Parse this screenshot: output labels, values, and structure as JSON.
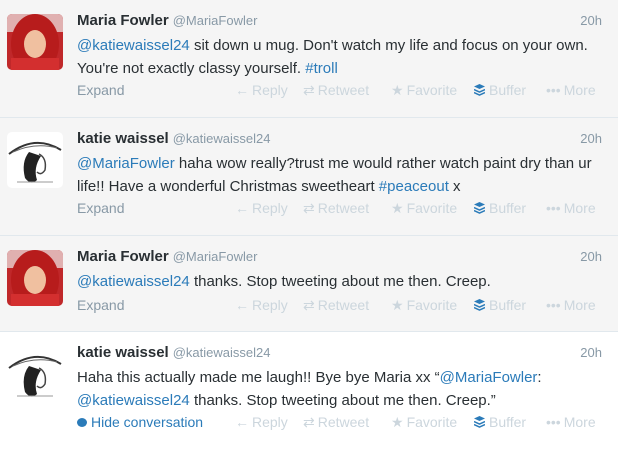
{
  "tweets": [
    {
      "name": "Maria Fowler",
      "handle": "@MariaFowler",
      "time": "20h",
      "text_parts": [
        {
          "t": "@katiewaissel24",
          "link": true
        },
        {
          "t": " sit down u mug. Don't watch my life and focus on your own. You're not exactly classy yourself. ",
          "link": false
        },
        {
          "t": "#troll",
          "link": true
        }
      ],
      "footer": "Expand",
      "avatar": "red-hair-avatar"
    },
    {
      "name": "katie waissel",
      "handle": "@katiewaissel24",
      "time": "20h",
      "text_parts": [
        {
          "t": "@MariaFowler",
          "link": true
        },
        {
          "t": " haha wow really?trust me would rather watch paint dry than ur life!! Have a wonderful Christmas sweetheart ",
          "link": false
        },
        {
          "t": "#peaceout",
          "link": true
        },
        {
          "t": " x",
          "link": false
        }
      ],
      "footer": "Expand",
      "avatar": "hat-sketch-avatar"
    },
    {
      "name": "Maria Fowler",
      "handle": "@MariaFowler",
      "time": "20h",
      "text_parts": [
        {
          "t": "@katiewaissel24",
          "link": true
        },
        {
          "t": " thanks. Stop tweeting about me then. Creep.",
          "link": false
        }
      ],
      "footer": "Expand",
      "avatar": "red-hair-avatar"
    },
    {
      "name": "katie waissel",
      "handle": "@katiewaissel24",
      "time": "20h",
      "text_parts": [
        {
          "t": "Haha this actually made me laugh!! Bye bye Maria xx “",
          "link": false
        },
        {
          "t": "@MariaFowler",
          "link": true
        },
        {
          "t": ": ",
          "link": false
        },
        {
          "t": "@katiewaissel24",
          "link": true
        },
        {
          "t": " thanks. Stop tweeting about me then. Creep.”",
          "link": false
        }
      ],
      "footer": "Hide conversation",
      "avatar": "hat-sketch-avatar"
    }
  ],
  "actions": {
    "reply": "Reply",
    "retweet": "Retweet",
    "favorite": "Favorite",
    "buffer": "Buffer",
    "more": "More"
  },
  "colors": {
    "link": "#2b7bb9",
    "muted": "#8899a6",
    "action": "#ccd6dd",
    "buffer": "#2b7bb9"
  }
}
